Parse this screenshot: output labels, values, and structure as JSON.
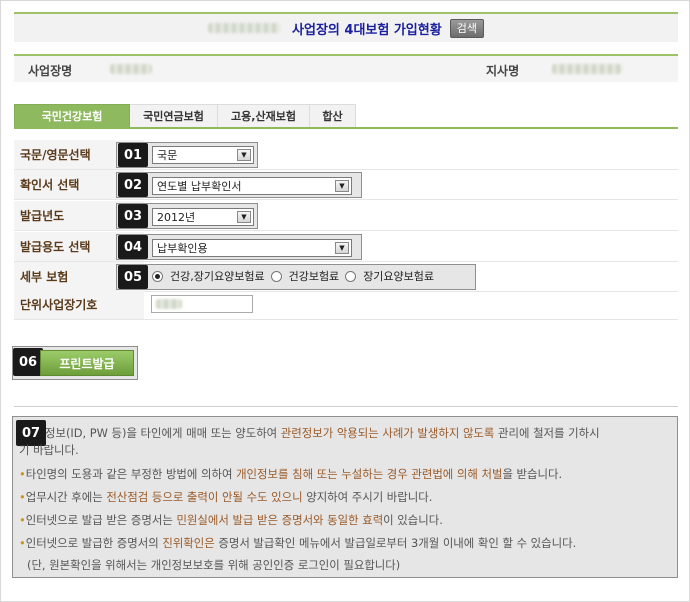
{
  "header": {
    "title": "사업장의 4대보험 가입현황",
    "search_button": "검색"
  },
  "info": {
    "business_name_label": "사업장명",
    "branch_label": "지사명"
  },
  "tabs": [
    {
      "label": "국민건강보험",
      "active": true
    },
    {
      "label": "국민연금보험",
      "active": false
    },
    {
      "label": "고용,산재보험",
      "active": false
    },
    {
      "label": "합산",
      "active": false
    }
  ],
  "form": {
    "language": {
      "label": "국문/영문선택",
      "step": "01",
      "value": "국문"
    },
    "certificate": {
      "label": "확인서 선택",
      "step": "02",
      "value": "연도별 납부확인서"
    },
    "year": {
      "label": "발급년도",
      "step": "03",
      "value": "2012년"
    },
    "purpose": {
      "label": "발급용도 선택",
      "step": "04",
      "value": "납부확인용"
    },
    "detail": {
      "label": "세부 보험",
      "step": "05",
      "options": [
        "건강,장기요양보험료",
        "건강보험료",
        "장기요양보험료"
      ],
      "selected": "건강,장기요양보험료"
    },
    "unit_code": {
      "label": "단위사업장기호"
    }
  },
  "print": {
    "step": "06",
    "label": "프린트발급"
  },
  "notice": {
    "step": "07",
    "line1_a": "정보(ID, PW 등)을 타인에게 매매 또는 양도하여 ",
    "line1_b": "관련정보가 악용되는 사례가 발생하지 않도록",
    "line1_c": " 관리에 철저를 기하시",
    "line1_d": "기 바랍니다.",
    "line2_a": "타인명의 도용과 같은 부정한 방법에 의하여 ",
    "line2_b": "개인정보를 침해 또는 누설하는 경우 관련법에 의해 처벌",
    "line2_c": "을 받습니다.",
    "line3_a": "업무시간 후에는 ",
    "line3_b": "전산점검 등으로 출력이 안될 수도 있으니",
    "line3_c": " 양지하여 주시기 바랍니다.",
    "line4_a": "인터넷으로 발급 받은 증명서는 ",
    "line4_b": "민원실에서 발급 받은 증명서와 동일한 효력",
    "line4_c": "이 있습니다.",
    "line5_a": "인터넷으로 발급한 증명서의 ",
    "line5_b": "진위확인은",
    "line5_c": " 증명서 발급확인 메뉴에서 발급일로부터 3개월 이내에 확인 할 수 있습니다.",
    "line6": "(단, 원본확인을 위해서는 개인정보보호를 위해 공인인증 로그인이 필요합니다)"
  },
  "colors": {
    "accent_green": "#8fb95e",
    "title_blue": "#1a1f9c",
    "highlight_brown": "#9a5a28",
    "bullet_gold": "#c8961e"
  }
}
